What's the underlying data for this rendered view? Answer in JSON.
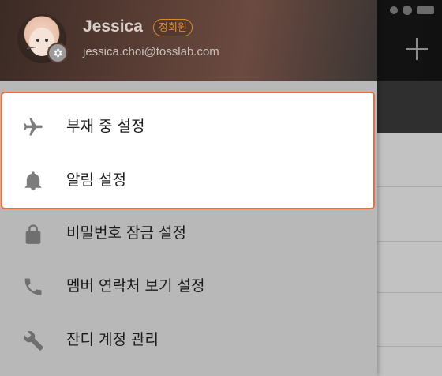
{
  "profile": {
    "name": "Jessica",
    "role_badge": "정회원",
    "email": "jessica.choi@tosslab.com"
  },
  "menu": {
    "items": [
      {
        "label": "부재 중 설정",
        "icon": "airplane-icon"
      },
      {
        "label": "알림 설정",
        "icon": "bell-icon"
      },
      {
        "label": "비밀번호 잠금 설정",
        "icon": "lock-icon"
      },
      {
        "label": "멤버 연락처 보기 설정",
        "icon": "phone-icon"
      },
      {
        "label": "잔디 계정 관리",
        "icon": "wrench-icon"
      }
    ]
  },
  "colors": {
    "highlight_border": "#f06a3a",
    "badge": "#e08a2a",
    "icon_gray": "#7c7c7c"
  }
}
